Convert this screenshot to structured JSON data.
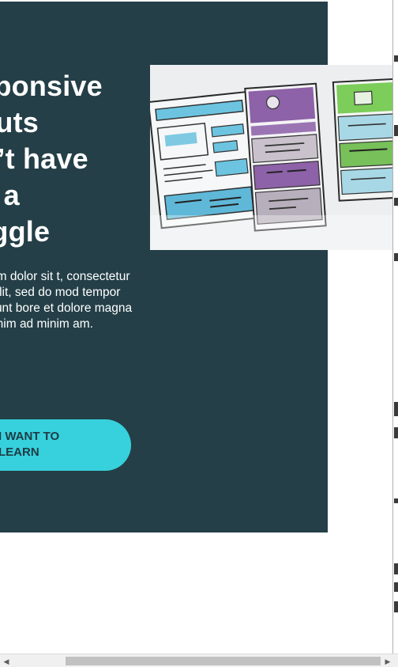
{
  "hero": {
    "title": "esponsive\nyouts\non’t have\n be a\nruggle",
    "body": "m ipsum dolor sit t, consectetur scing elit, sed do mod tempor incididunt bore et dolore magna a. Ut enim ad minim am.",
    "cta_label": "I WANT TO\nLEARN"
  },
  "colors": {
    "hero_background": "#243f47",
    "cta_background": "#36d1dc",
    "cta_text": "#1f3a44",
    "title_text": "#ffffff"
  },
  "illustration": {
    "description_icon": "wireframe-sketch-image"
  },
  "scrollbar": {
    "left_arrow": "◀",
    "right_arrow": "▶"
  }
}
